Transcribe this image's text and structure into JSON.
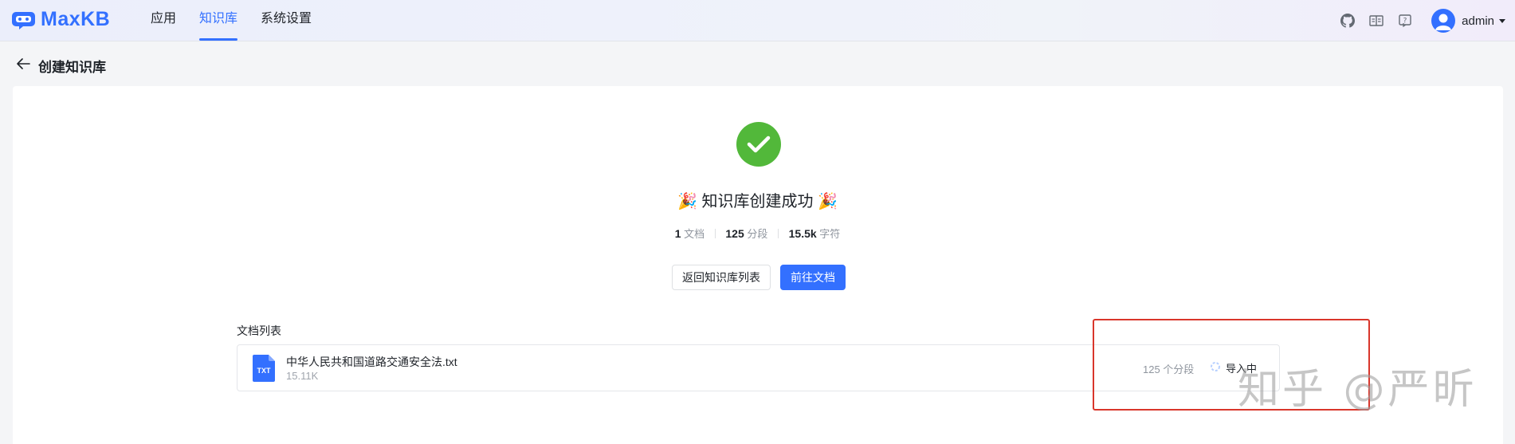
{
  "app": {
    "name": "MaxKB"
  },
  "nav": {
    "items": [
      {
        "label": "应用"
      },
      {
        "label": "知识库"
      },
      {
        "label": "系统设置"
      }
    ],
    "active": "知识库"
  },
  "user": {
    "name": "admin"
  },
  "toolbar_icons": [
    "github-icon",
    "book-icon",
    "help-icon"
  ],
  "page": {
    "title": "创建知识库"
  },
  "result": {
    "title": "🎉 知识库创建成功 🎉",
    "stats": {
      "doc_count": "1",
      "doc_unit": "文档",
      "segment_count": "125",
      "segment_unit": "分段",
      "char_count": "15.5k",
      "char_unit": "字符"
    },
    "buttons": {
      "back": "返回知识库列表",
      "go": "前往文档"
    }
  },
  "doc_list": {
    "label": "文档列表",
    "items": [
      {
        "icon_text": "TXT",
        "name": "中华人民共和国道路交通安全法.txt",
        "size": "15.11K",
        "segments": "125 个分段",
        "status": "导入中"
      }
    ]
  },
  "watermark": "知乎 @严昕",
  "colors": {
    "brand": "#3370ff",
    "success": "#52b83a",
    "annotation": "#d9362b"
  }
}
